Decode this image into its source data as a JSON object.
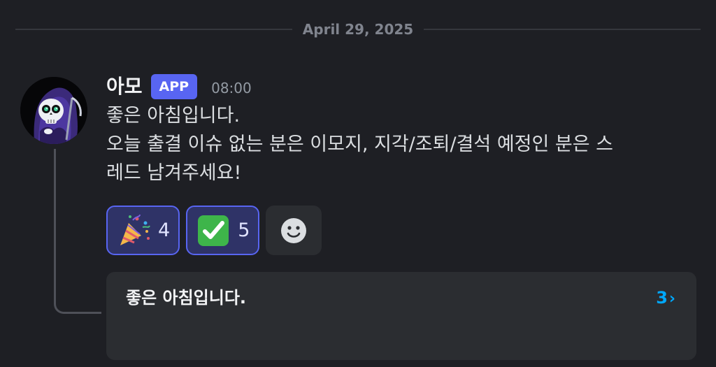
{
  "date_divider": "April 29, 2025",
  "message": {
    "author": "아모",
    "badge": "APP",
    "time": "08:00",
    "lines": [
      "좋은 아침입니다.",
      "오늘 출결 이슈 없는 분은 이모지, 지각/조퇴/결석 예정인 분은 스",
      "레드 남겨주세요!"
    ]
  },
  "reactions": [
    {
      "emoji": "party-popper",
      "count": "4",
      "active": true
    },
    {
      "emoji": "white-check-mark",
      "count": "5",
      "active": true
    }
  ],
  "add_reaction_icon": "smiley-add-reaction-icon",
  "thread": {
    "title": "좋은 아침입니다.",
    "count": "3",
    "chevron": "›"
  },
  "colors": {
    "background": "#1e1f24",
    "badge": "#5865f2",
    "thread_count": "#00a8fc",
    "reaction_active_bg": "#2f3367",
    "reaction_active_border": "#5865f2"
  }
}
